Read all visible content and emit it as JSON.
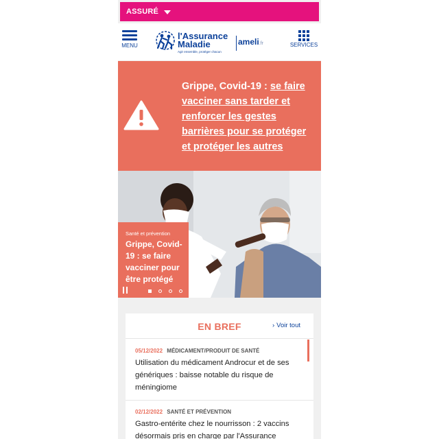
{
  "topbar": {
    "profile_label": "ASSURÉ"
  },
  "header": {
    "menu_label": "MENU",
    "logo_line1": "l'Assurance",
    "logo_line2": "Maladie",
    "logo_tagline": "Agir ensemble, protéger chacun",
    "ameli": "ameli",
    "ameli_suffix": ".fr",
    "services_label": "SERVICES"
  },
  "alert": {
    "prefix": "Grippe, Covid-19 : ",
    "link_text": "se faire vacciner sans tarder et renforcer les gestes barrières pour se protéger et protéger les autres"
  },
  "hero": {
    "category": "Santé et prévention",
    "title": "Grippe, Covid-19 : se faire vacciner pour être protégé",
    "slides_total": 4,
    "active_slide": 1
  },
  "en_bref": {
    "title": "EN BREF",
    "voir_tout": "Voir tout",
    "items": [
      {
        "date": "05/12/2022",
        "category": "MÉDICAMENT/PRODUIT DE SANTÉ",
        "text": "Utilisation du médicament Androcur et de ses génériques : baisse notable du risque de méningiome"
      },
      {
        "date": "02/12/2022",
        "category": "SANTÉ ET PRÉVENTION",
        "text": "Gastro-entérite chez le nourrisson : 2 vaccins désormais pris en charge par l'Assurance"
      }
    ]
  },
  "colors": {
    "brand_pink": "#e5127d",
    "brand_blue": "#0c419a",
    "accent_coral": "#e96f5d"
  },
  "icons": [
    "caret-down-icon",
    "hamburger-icon",
    "grid-icon",
    "warning-icon",
    "pause-icon"
  ]
}
